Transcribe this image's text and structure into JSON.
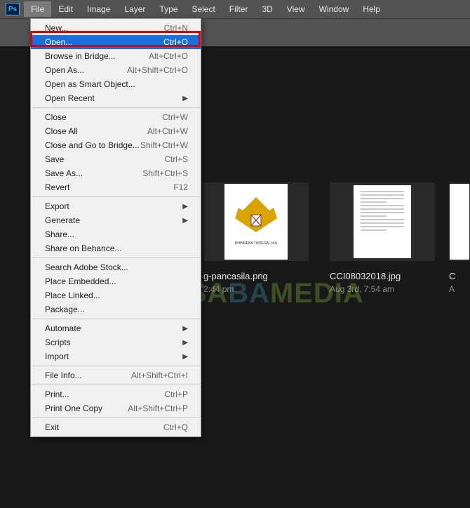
{
  "menubar": {
    "items": [
      "File",
      "Edit",
      "Image",
      "Layer",
      "Type",
      "Select",
      "Filter",
      "3D",
      "View",
      "Window",
      "Help"
    ],
    "active_index": 0
  },
  "dropdown": {
    "groups": [
      [
        {
          "label": "New...",
          "shortcut": "Ctrl+N",
          "submenu": false
        },
        {
          "label": "Open...",
          "shortcut": "Ctrl+O",
          "submenu": false,
          "highlight": true
        },
        {
          "label": "Browse in Bridge...",
          "shortcut": "Alt+Ctrl+O",
          "submenu": false
        },
        {
          "label": "Open As...",
          "shortcut": "Alt+Shift+Ctrl+O",
          "submenu": false
        },
        {
          "label": "Open as Smart Object...",
          "shortcut": "",
          "submenu": false
        },
        {
          "label": "Open Recent",
          "shortcut": "",
          "submenu": true
        }
      ],
      [
        {
          "label": "Close",
          "shortcut": "Ctrl+W",
          "submenu": false
        },
        {
          "label": "Close All",
          "shortcut": "Alt+Ctrl+W",
          "submenu": false
        },
        {
          "label": "Close and Go to Bridge...",
          "shortcut": "Shift+Ctrl+W",
          "submenu": false
        },
        {
          "label": "Save",
          "shortcut": "Ctrl+S",
          "submenu": false
        },
        {
          "label": "Save As...",
          "shortcut": "Shift+Ctrl+S",
          "submenu": false
        },
        {
          "label": "Revert",
          "shortcut": "F12",
          "submenu": false
        }
      ],
      [
        {
          "label": "Export",
          "shortcut": "",
          "submenu": true
        },
        {
          "label": "Generate",
          "shortcut": "",
          "submenu": true
        },
        {
          "label": "Share...",
          "shortcut": "",
          "submenu": false
        },
        {
          "label": "Share on Behance...",
          "shortcut": "",
          "submenu": false
        }
      ],
      [
        {
          "label": "Search Adobe Stock...",
          "shortcut": "",
          "submenu": false
        },
        {
          "label": "Place Embedded...",
          "shortcut": "",
          "submenu": false
        },
        {
          "label": "Place Linked...",
          "shortcut": "",
          "submenu": false
        },
        {
          "label": "Package...",
          "shortcut": "",
          "submenu": false
        }
      ],
      [
        {
          "label": "Automate",
          "shortcut": "",
          "submenu": true
        },
        {
          "label": "Scripts",
          "shortcut": "",
          "submenu": true
        },
        {
          "label": "Import",
          "shortcut": "",
          "submenu": true
        }
      ],
      [
        {
          "label": "File Info...",
          "shortcut": "Alt+Shift+Ctrl+I",
          "submenu": false
        }
      ],
      [
        {
          "label": "Print...",
          "shortcut": "Ctrl+P",
          "submenu": false
        },
        {
          "label": "Print One Copy",
          "shortcut": "Alt+Shift+Ctrl+P",
          "submenu": false
        }
      ],
      [
        {
          "label": "Exit",
          "shortcut": "Ctrl+Q",
          "submenu": false
        }
      ]
    ]
  },
  "thumbs": [
    {
      "name": "g-pancasila.png",
      "date": "2:44 pm",
      "kind": "garuda"
    },
    {
      "name": "CCI08032018.jpg",
      "date": "Aug 3rd, 7:54 am",
      "kind": "doc"
    },
    {
      "name": "C",
      "date": "A",
      "kind": "white"
    }
  ],
  "watermark": {
    "part1": "NESA",
    "part2": "BA",
    "part3": "MEDIA"
  },
  "ps_label": "Ps"
}
